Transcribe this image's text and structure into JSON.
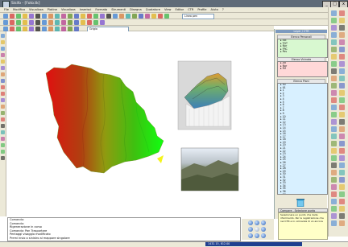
{
  "window": {
    "title": "Sisifo - [Foto.tk]",
    "minimize": "_",
    "maximize": "□",
    "close": "x"
  },
  "menu": [
    "File",
    "Modifica",
    "Visualizza",
    "Piatine",
    "Visualizza",
    "Inserisci",
    "Formato",
    "Strumenti",
    "Disegna",
    "Quotature",
    "View",
    "Editor",
    "CTR",
    "Profile",
    "Aiuto",
    "?"
  ],
  "toolbar": {
    "layer_combo": "Linea pen",
    "style_combo": "Grigio",
    "colors": [
      "#3b7fd6",
      "#d63b3b",
      "#3bb44a",
      "#e0b020",
      "#7a4fd0",
      "#222222",
      "#3b7fd6",
      "#d6793b",
      "#2fa7a7",
      "#b43b8f",
      "#5f8f2a",
      "#3b55c4",
      "#e0b020",
      "#d63b3b",
      "#3bb44a",
      "#7a4fd0",
      "#222222",
      "#3b7fd6",
      "#d6793b",
      "#2fa7a7",
      "#5f8f2a",
      "#3b55c4",
      "#b43b8f",
      "#e0b020",
      "#d63b3b",
      "#3bb44a"
    ]
  },
  "right_panel": {
    "header": "Layer / CTR",
    "section1": {
      "title": "Elenco Personali",
      "items": [
        "▸ Est",
        "▸ TDT",
        "▸ Nor",
        "▸ FRC",
        "▸ Pos"
      ]
    },
    "section2": {
      "title": "Elenco Vicinato",
      "items": [
        "▸ Alt",
        "▸ Nor",
        "▸ Rif"
      ]
    },
    "section3": {
      "title": "Elenco Piani",
      "items": [
        "▸ 90",
        "▸ 91",
        "▸ 1",
        "▸ 2",
        "▸ 3",
        "▸ 4",
        "▸ 5",
        "▸ 6",
        "▸ 7",
        "▸ 8",
        "▸ 9",
        "▸ 10",
        "▸ 11",
        "▸ 12",
        "▸ 13",
        "▸ 14",
        "▸ 15",
        "▸ 16",
        "▸ 17",
        "▸ 18",
        "▸ 19",
        "▸ 20",
        "▸ 21",
        "▸ 22",
        "▸ 23",
        "▸ 24",
        "▸ 25",
        "▸ 26",
        "▸ 27",
        "▸ 28",
        "▸ 29",
        "▸ 30",
        "▸ 31",
        "▸ 32",
        "▸ 33",
        "▸ 34",
        "▸ 35",
        "▸ 36",
        "▸ 37",
        "▸ 38"
      ]
    },
    "recycle_label": "",
    "help_header": "Compare - Selezione punto",
    "help_text": "Selezionare un punto che della riferimento. Per la registrazione che nel CTR e in vicinanza di un ancora"
  },
  "command_lines": [
    "Comando:",
    "Comando:",
    "Rigenerazione in corso",
    "Comando: Pan Trasportare",
    "Pentaggi visaggio modificato",
    "Premi invio o sinistro al mappare singolare"
  ],
  "status": {
    "coords": "1432.15, 812.00"
  }
}
